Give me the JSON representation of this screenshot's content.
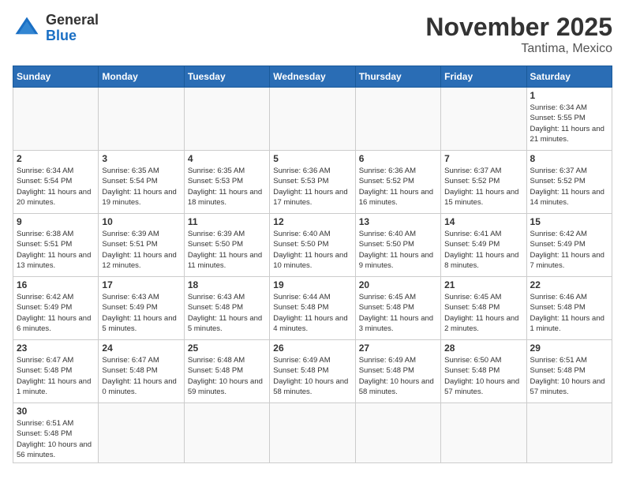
{
  "header": {
    "logo_general": "General",
    "logo_blue": "Blue",
    "month_title": "November 2025",
    "location": "Tantima, Mexico"
  },
  "days_of_week": [
    "Sunday",
    "Monday",
    "Tuesday",
    "Wednesday",
    "Thursday",
    "Friday",
    "Saturday"
  ],
  "weeks": [
    [
      {
        "day": "",
        "info": ""
      },
      {
        "day": "",
        "info": ""
      },
      {
        "day": "",
        "info": ""
      },
      {
        "day": "",
        "info": ""
      },
      {
        "day": "",
        "info": ""
      },
      {
        "day": "",
        "info": ""
      },
      {
        "day": "1",
        "info": "Sunrise: 6:34 AM\nSunset: 5:55 PM\nDaylight: 11 hours and 21 minutes."
      }
    ],
    [
      {
        "day": "2",
        "info": "Sunrise: 6:34 AM\nSunset: 5:54 PM\nDaylight: 11 hours and 20 minutes."
      },
      {
        "day": "3",
        "info": "Sunrise: 6:35 AM\nSunset: 5:54 PM\nDaylight: 11 hours and 19 minutes."
      },
      {
        "day": "4",
        "info": "Sunrise: 6:35 AM\nSunset: 5:53 PM\nDaylight: 11 hours and 18 minutes."
      },
      {
        "day": "5",
        "info": "Sunrise: 6:36 AM\nSunset: 5:53 PM\nDaylight: 11 hours and 17 minutes."
      },
      {
        "day": "6",
        "info": "Sunrise: 6:36 AM\nSunset: 5:52 PM\nDaylight: 11 hours and 16 minutes."
      },
      {
        "day": "7",
        "info": "Sunrise: 6:37 AM\nSunset: 5:52 PM\nDaylight: 11 hours and 15 minutes."
      },
      {
        "day": "8",
        "info": "Sunrise: 6:37 AM\nSunset: 5:52 PM\nDaylight: 11 hours and 14 minutes."
      }
    ],
    [
      {
        "day": "9",
        "info": "Sunrise: 6:38 AM\nSunset: 5:51 PM\nDaylight: 11 hours and 13 minutes."
      },
      {
        "day": "10",
        "info": "Sunrise: 6:39 AM\nSunset: 5:51 PM\nDaylight: 11 hours and 12 minutes."
      },
      {
        "day": "11",
        "info": "Sunrise: 6:39 AM\nSunset: 5:50 PM\nDaylight: 11 hours and 11 minutes."
      },
      {
        "day": "12",
        "info": "Sunrise: 6:40 AM\nSunset: 5:50 PM\nDaylight: 11 hours and 10 minutes."
      },
      {
        "day": "13",
        "info": "Sunrise: 6:40 AM\nSunset: 5:50 PM\nDaylight: 11 hours and 9 minutes."
      },
      {
        "day": "14",
        "info": "Sunrise: 6:41 AM\nSunset: 5:49 PM\nDaylight: 11 hours and 8 minutes."
      },
      {
        "day": "15",
        "info": "Sunrise: 6:42 AM\nSunset: 5:49 PM\nDaylight: 11 hours and 7 minutes."
      }
    ],
    [
      {
        "day": "16",
        "info": "Sunrise: 6:42 AM\nSunset: 5:49 PM\nDaylight: 11 hours and 6 minutes."
      },
      {
        "day": "17",
        "info": "Sunrise: 6:43 AM\nSunset: 5:49 PM\nDaylight: 11 hours and 5 minutes."
      },
      {
        "day": "18",
        "info": "Sunrise: 6:43 AM\nSunset: 5:48 PM\nDaylight: 11 hours and 5 minutes."
      },
      {
        "day": "19",
        "info": "Sunrise: 6:44 AM\nSunset: 5:48 PM\nDaylight: 11 hours and 4 minutes."
      },
      {
        "day": "20",
        "info": "Sunrise: 6:45 AM\nSunset: 5:48 PM\nDaylight: 11 hours and 3 minutes."
      },
      {
        "day": "21",
        "info": "Sunrise: 6:45 AM\nSunset: 5:48 PM\nDaylight: 11 hours and 2 minutes."
      },
      {
        "day": "22",
        "info": "Sunrise: 6:46 AM\nSunset: 5:48 PM\nDaylight: 11 hours and 1 minute."
      }
    ],
    [
      {
        "day": "23",
        "info": "Sunrise: 6:47 AM\nSunset: 5:48 PM\nDaylight: 11 hours and 1 minute."
      },
      {
        "day": "24",
        "info": "Sunrise: 6:47 AM\nSunset: 5:48 PM\nDaylight: 11 hours and 0 minutes."
      },
      {
        "day": "25",
        "info": "Sunrise: 6:48 AM\nSunset: 5:48 PM\nDaylight: 10 hours and 59 minutes."
      },
      {
        "day": "26",
        "info": "Sunrise: 6:49 AM\nSunset: 5:48 PM\nDaylight: 10 hours and 58 minutes."
      },
      {
        "day": "27",
        "info": "Sunrise: 6:49 AM\nSunset: 5:48 PM\nDaylight: 10 hours and 58 minutes."
      },
      {
        "day": "28",
        "info": "Sunrise: 6:50 AM\nSunset: 5:48 PM\nDaylight: 10 hours and 57 minutes."
      },
      {
        "day": "29",
        "info": "Sunrise: 6:51 AM\nSunset: 5:48 PM\nDaylight: 10 hours and 57 minutes."
      }
    ],
    [
      {
        "day": "30",
        "info": "Sunrise: 6:51 AM\nSunset: 5:48 PM\nDaylight: 10 hours and 56 minutes."
      },
      {
        "day": "",
        "info": ""
      },
      {
        "day": "",
        "info": ""
      },
      {
        "day": "",
        "info": ""
      },
      {
        "day": "",
        "info": ""
      },
      {
        "day": "",
        "info": ""
      },
      {
        "day": "",
        "info": ""
      }
    ]
  ]
}
